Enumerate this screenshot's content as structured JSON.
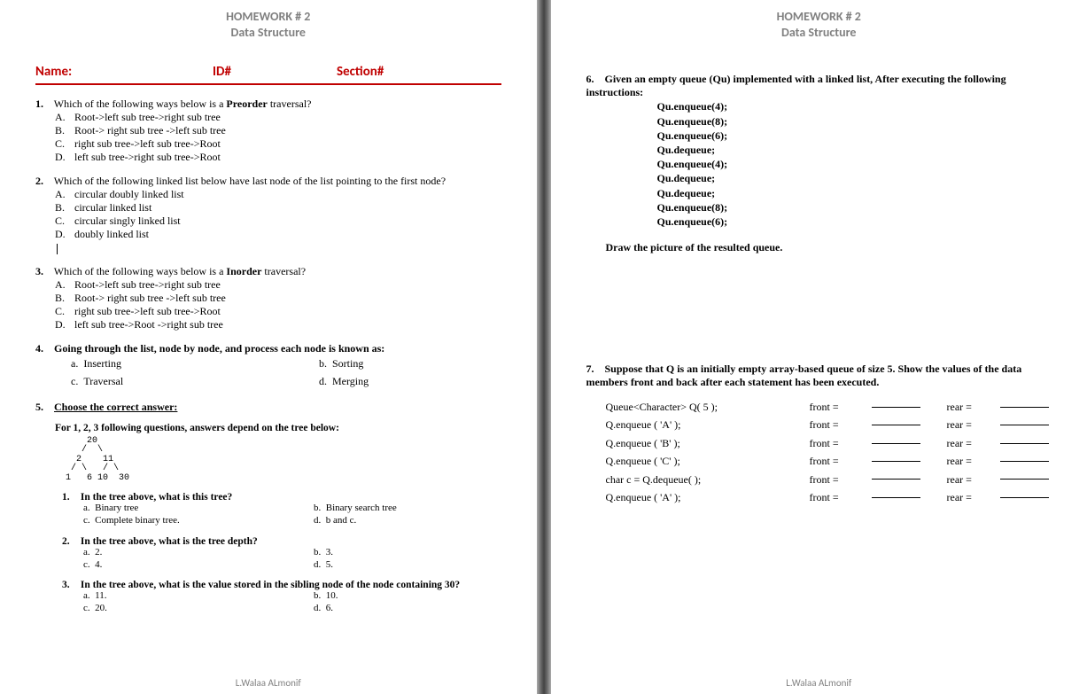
{
  "header": {
    "title": "HOMEWORK # 2",
    "subtitle": "Data Structure"
  },
  "footer": "L.Walaa ALmonif",
  "labels": {
    "name": "Name:",
    "id": "ID#",
    "section": "Section#"
  },
  "q1": {
    "num": "1.",
    "prefix": "Which of the following ways below is a ",
    "bold": "Preorder",
    "suffix": " traversal?",
    "a": "Root->left sub tree->right sub tree",
    "b": "Root-> right sub tree ->left sub tree",
    "c": "right sub tree->left sub tree->Root",
    "d": "left sub tree->right sub tree->Root"
  },
  "q2": {
    "num": "2.",
    "text": "Which of the following linked list below have last node of the list pointing to the first node?",
    "a": "circular doubly linked list",
    "b": "circular linked list",
    "c": "circular singly linked list",
    "d": "doubly linked list"
  },
  "q3": {
    "num": "3.",
    "prefix": "Which of the following ways below is a ",
    "bold": "Inorder",
    "suffix": " traversal?",
    "a": "Root->left sub tree->right sub tree",
    "b": "Root-> right sub tree ->left sub tree",
    "c": "right sub tree->left sub tree->Root",
    "d": "left sub tree->Root ->right sub tree"
  },
  "q4": {
    "num": "4.",
    "text": "Going through the list, node by node, and process each node is known as:",
    "a": "Inserting",
    "b": "Sorting",
    "c": "Traversal",
    "d": "Merging"
  },
  "q5": {
    "num": "5.",
    "head": "Choose the correct answer:",
    "sub": "For 1, 2, 3 following questions, answers depend on the tree below:",
    "tree": "      20\n     /  \\\n    2    11\n   / \\   / \\\n  1   6 10  30",
    "s1": {
      "num": "1.",
      "q": "In the tree above, what is this tree?",
      "a": "Binary tree",
      "b": "Binary search tree",
      "c": "Complete binary tree.",
      "d": "b and c."
    },
    "s2": {
      "num": "2.",
      "q": "In the tree above,  what is the tree depth?",
      "a": "2.",
      "b": "3.",
      "c": "4.",
      "d": "5."
    },
    "s3": {
      "num": "3.",
      "q": "In the tree above, what is the value stored in the sibling node of the node containing 30?",
      "a": "11.",
      "b": "10.",
      "c": "20.",
      "d": "6."
    }
  },
  "q6": {
    "num": "6.",
    "text": "Given an empty queue (Qu) implemented with a linked list, After executing the following instructions:",
    "code": [
      "Qu.enqueue(4);",
      "Qu.enqueue(8);",
      "Qu.enqueue(6);",
      "Qu.dequeue;",
      "Qu.enqueue(4);",
      "Qu.dequeue;",
      "Qu.dequeue;",
      "Qu.enqueue(8);",
      "Qu.enqueue(6);"
    ],
    "draw": "Draw the picture of the resulted queue."
  },
  "q7": {
    "num": "7.",
    "text": "Suppose that Q is an initially empty array-based queue of size 5. Show the values of  the data members front and back after each statement has been executed.",
    "front": "front =",
    "rear": "rear =",
    "rows": [
      "Queue<Character> Q( 5 );",
      "Q.enqueue ( 'A' );",
      "Q.enqueue ( 'B' );",
      "Q.enqueue ( 'C' );",
      "char c = Q.dequeue( );",
      "Q.enqueue ( 'A' );"
    ]
  },
  "let": {
    "A": "A.",
    "B": "B.",
    "C": "C.",
    "D": "D.",
    "a": "a.",
    "b": "b.",
    "c": "c.",
    "d": "d."
  }
}
